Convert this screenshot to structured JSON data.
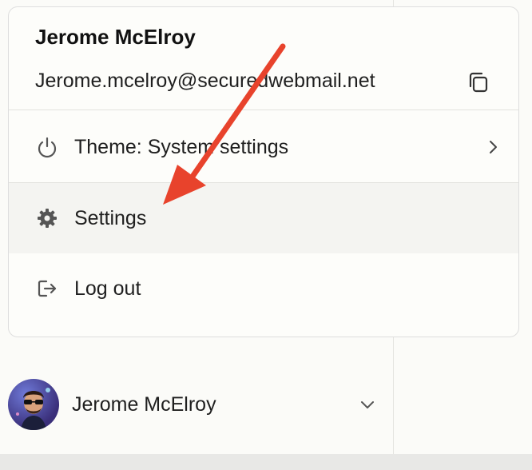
{
  "menu": {
    "user_name": "Jerome McElroy",
    "email": "Jerome.mcelroy@securedwebmail.net",
    "items": [
      {
        "label": "Theme: System settings",
        "icon": "power-icon",
        "has_submenu": true
      },
      {
        "label": "Settings",
        "icon": "gear-icon",
        "hovered": true
      },
      {
        "label": "Log out",
        "icon": "logout-icon"
      }
    ]
  },
  "account": {
    "name": "Jerome McElroy",
    "icon": "chevron-down-icon"
  },
  "colors": {
    "background": "#fbfbf8",
    "menu_background": "#fdfdfa",
    "hover_background": "#f4f4f1",
    "annotation_arrow": "#e8432c"
  }
}
